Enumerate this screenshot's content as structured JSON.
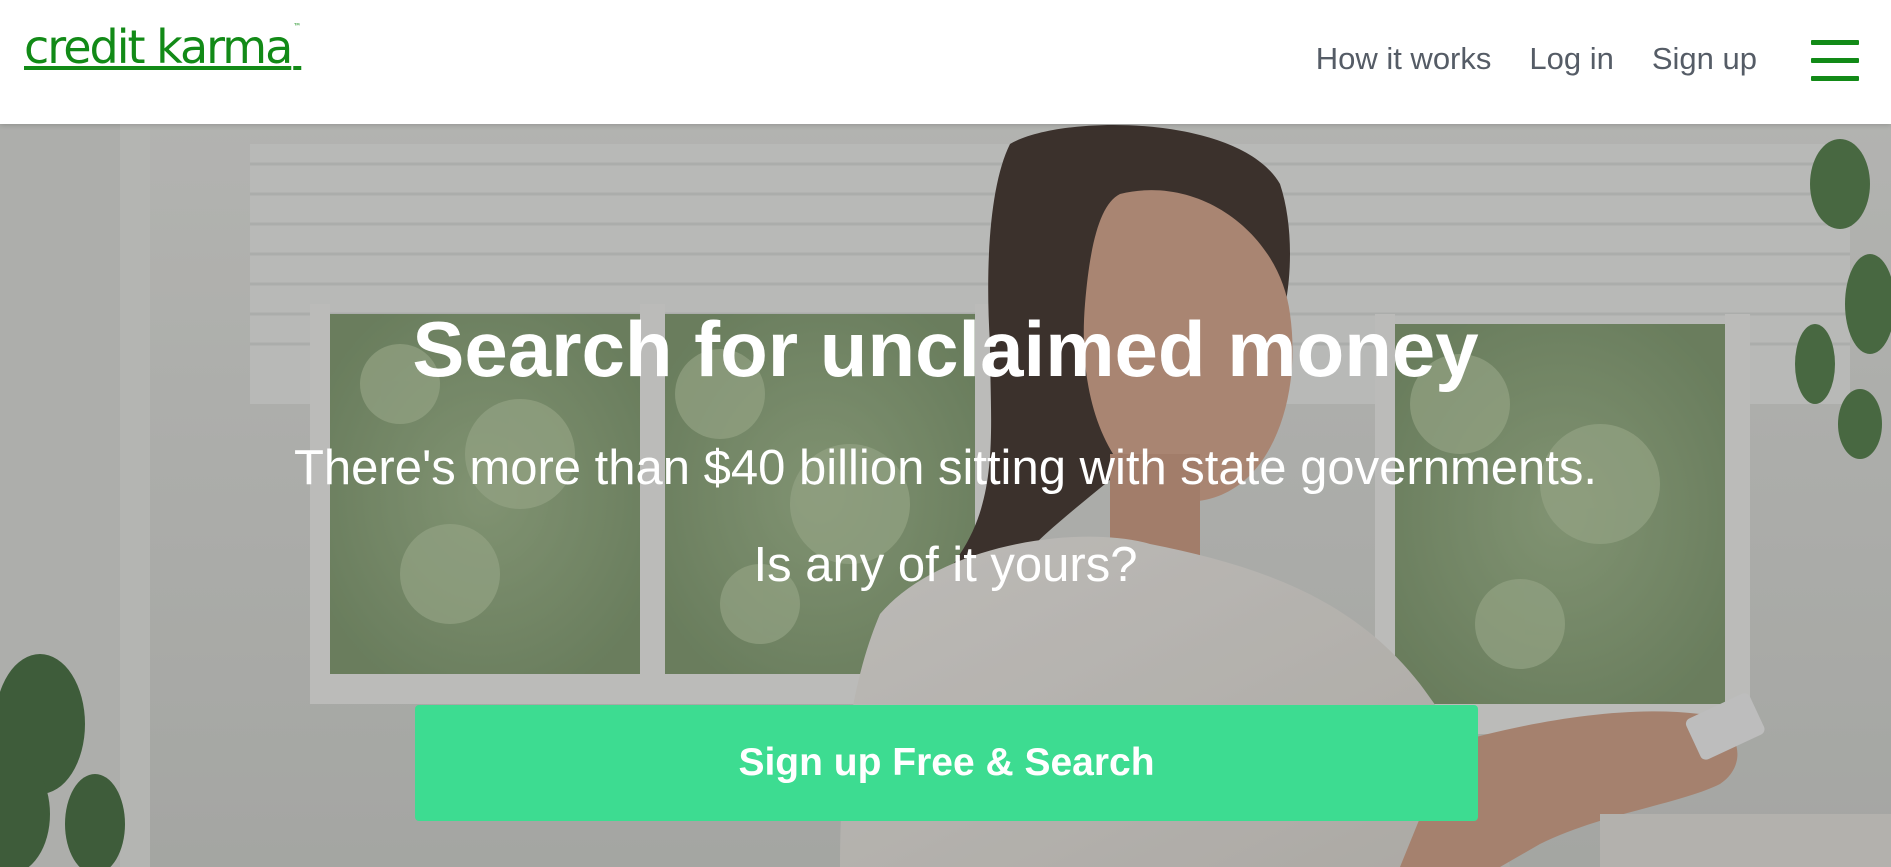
{
  "header": {
    "logo_text": "credit karma",
    "logo_mark": "™",
    "nav": {
      "how_it_works": "How it works",
      "log_in": "Log in",
      "sign_up": "Sign up"
    },
    "menu_icon": "hamburger-menu-icon"
  },
  "hero": {
    "headline": "Search for unclaimed money",
    "subtext_line1": "There's more than $40 billion sitting with state governments.",
    "subtext_line2": "Is any of it yours?",
    "cta_label": "Sign up Free & Search"
  },
  "colors": {
    "brand_green": "#128a17",
    "cta_green": "#3ddc91",
    "nav_text": "#555c66"
  }
}
